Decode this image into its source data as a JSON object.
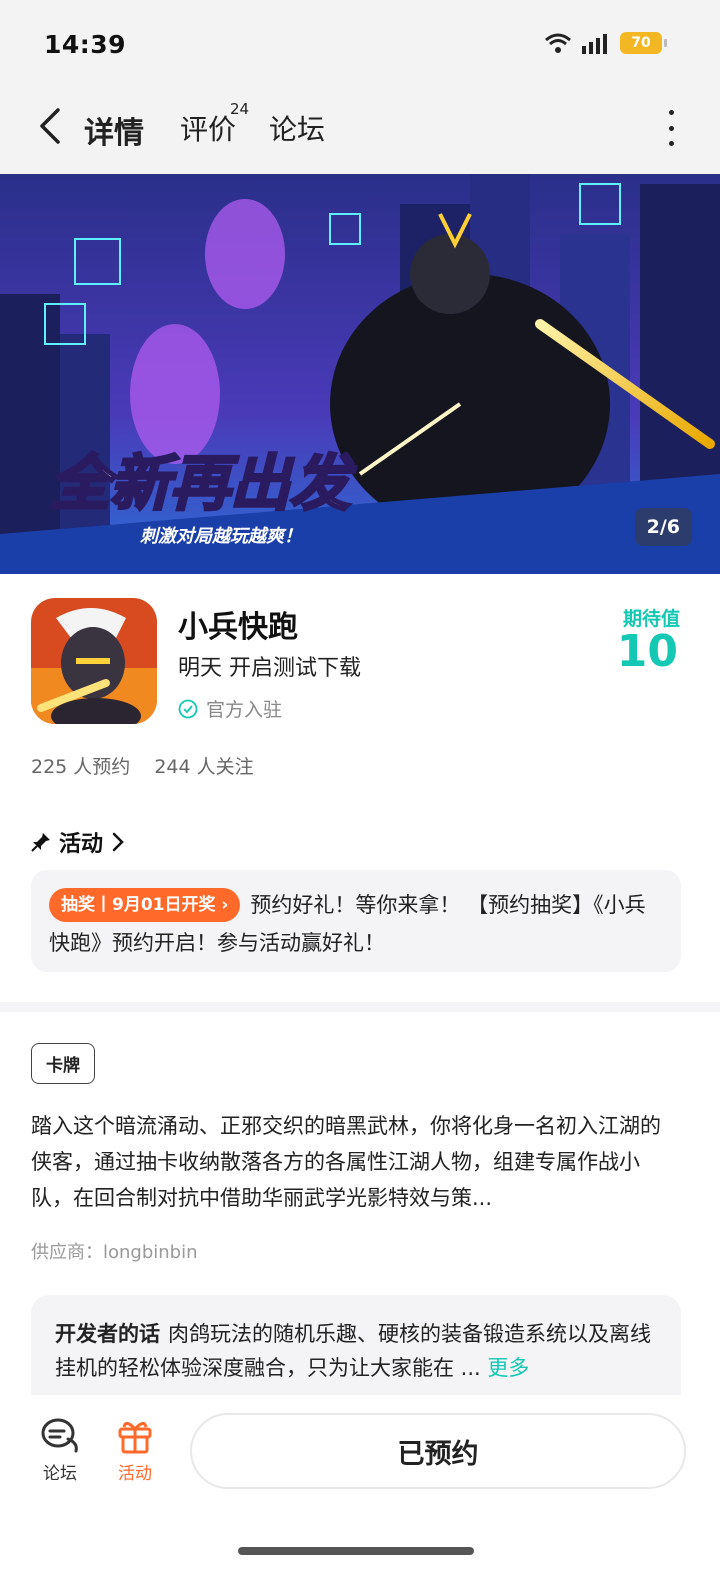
{
  "status_bar": {
    "time": "14:39",
    "battery": "70"
  },
  "nav": {
    "tabs": [
      {
        "label": "详情"
      },
      {
        "label": "评价",
        "badge": "24"
      },
      {
        "label": "论坛"
      }
    ]
  },
  "banner": {
    "headline": "全新再出发",
    "tagline": "刺激对局越玩越爽！",
    "counter": "2/6"
  },
  "app": {
    "name": "小兵快跑",
    "subtitle": "明天 开启测试下载",
    "official": "官方入驻",
    "expectation_label": "期待值",
    "expectation_value": "10",
    "reservations": "225 人预约",
    "followers": "244 人关注"
  },
  "activity": {
    "title": "活动",
    "badge": "抽奖丨9月01日开奖 ›",
    "text": "预约好礼！等你来拿！ 【预约抽奖】《小兵快跑》预约开启！参与活动赢好礼！"
  },
  "description": {
    "tag": "卡牌",
    "text": "踏入这个暗流涌动、正邪交织的暗黑武林，你将化身一名初入江湖的侠客，通过抽卡收纳散落各方的各属性江湖人物，组建专属作战小队，在回合制对抗中借助华丽武学光影特效与策...",
    "supplier": "供应商：longbinbin"
  },
  "developer": {
    "label": "开发者的话",
    "text": "肉鸽玩法的随机乐趣、硬核的装备锻造系统以及离线挂机的轻松体验深度融合，只为让大家能在 ...",
    "more": "更多"
  },
  "bottom_bar": {
    "forum_label": "论坛",
    "activity_label": "活动",
    "reserve_label": "已预约"
  },
  "colors": {
    "accent": "#14c8b4",
    "orange": "#ff6a2b"
  }
}
